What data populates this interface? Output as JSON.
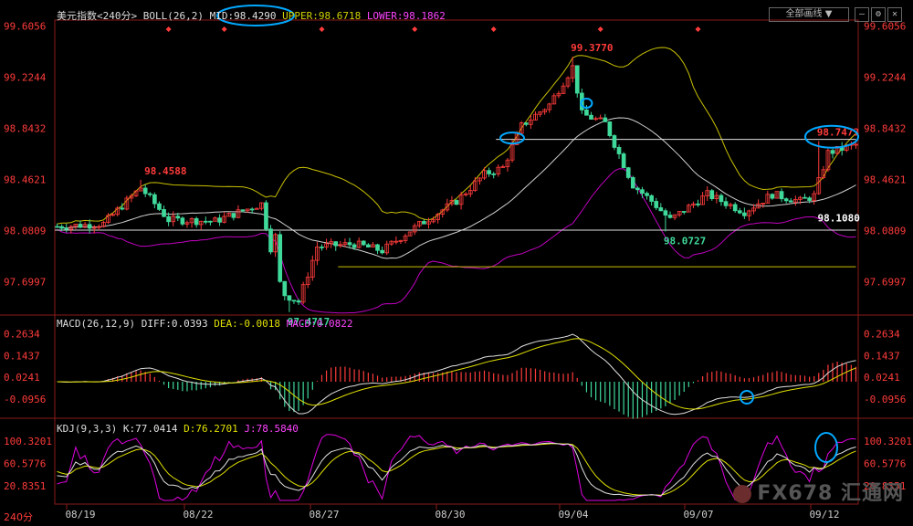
{
  "header": {
    "boll_title": "美元指数",
    "boll_period": "<240分>",
    "boll_label": "BOLL(26,2)",
    "mid": "MID:98.4290",
    "upper": "UPPER:98.6718",
    "lower": "LOWER:98.1862",
    "macd_label": "MACD(26,12,9)",
    "diff": "DIFF:0.0393",
    "dea": "DEA:-0.0018",
    "macd": "MACD:0.0822",
    "kdj_label": "KDJ(9,3,3)",
    "k": "K:77.0414",
    "d": "D:76.2701",
    "j": "J:78.5840",
    "dropdown": "全部画线",
    "period_tag": "240分",
    "watermark": "FX678 汇通网"
  },
  "colors": {
    "up": "#ff3b3b",
    "down": "#3fd99a",
    "boll_band": "#c8c000",
    "boll_mid": "#d0d0d0",
    "lower_band": "#c000c0",
    "axis_label": "#ff3b3b",
    "annot_circle": "#00a8ff",
    "dea": "#e0e000",
    "diff": "#e0e0e0",
    "kdj_j": "#e000e0"
  },
  "chart_data": [
    {
      "type": "candlestick",
      "title": "",
      "y_ticks": [
        "99.6056",
        "99.2244",
        "98.8432",
        "98.4621",
        "98.0809",
        "97.6997"
      ],
      "ylim": [
        97.47,
        99.65
      ],
      "x_ticks": [
        "08/19",
        "08/22",
        "08/27",
        "08/30",
        "09/04",
        "09/07",
        "09/12"
      ],
      "annotations": [
        {
          "label": "98.4588",
          "value": 98.4588,
          "bar": 18,
          "color": "up"
        },
        {
          "label": "97.4717",
          "value": 97.4717,
          "bar": 50,
          "color": "down"
        },
        {
          "label": "99.3770",
          "value": 99.377,
          "bar": 111,
          "color": "up"
        },
        {
          "label": "98.0727",
          "value": 98.0727,
          "bar": 131,
          "color": "down"
        },
        {
          "label": "98.7473",
          "value": 98.7473,
          "bar": 164,
          "color": "up"
        },
        {
          "label": "98.1080",
          "value": 98.108,
          "bar": 172,
          "color": "white"
        }
      ],
      "horizontal_lines": [
        {
          "value": 98.083,
          "from_bar": 0,
          "to_bar": 172,
          "color": "white"
        },
        {
          "value": 98.76,
          "from_bar": 95,
          "to_bar": 172,
          "color": "white"
        },
        {
          "value": 97.81,
          "from_bar": 61,
          "to_bar": 172,
          "color": "yellow"
        }
      ],
      "series": [
        {
          "name": "ohlc",
          "note": "generated"
        }
      ]
    },
    {
      "type": "bar+line",
      "title": "MACD(26,12,9)",
      "y_ticks": [
        "0.2634",
        "0.1437",
        "0.0241",
        "-0.0956"
      ],
      "ylim": [
        -0.2,
        0.29
      ]
    },
    {
      "type": "line",
      "title": "KDJ(9,3,3)",
      "y_ticks": [
        "100.3201",
        "60.5776",
        "20.8351"
      ],
      "ylim": [
        -5,
        115
      ]
    }
  ],
  "markers": {
    "diamond_bars": [
      24,
      36,
      57,
      77,
      94,
      117,
      138
    ]
  }
}
